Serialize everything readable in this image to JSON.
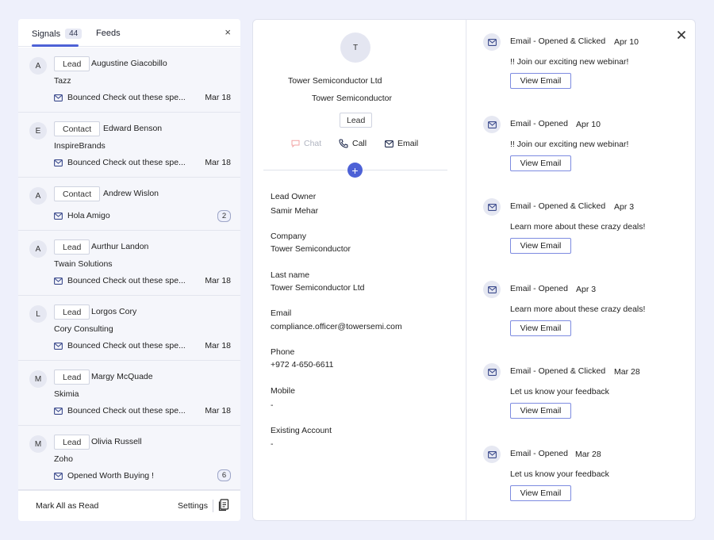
{
  "signals": {
    "tab_signals": "Signals",
    "signals_count": "44",
    "tab_feeds": "Feeds",
    "close_glyph": "×",
    "items": [
      {
        "avatar": "A",
        "type": "Lead",
        "name": "Augustine Giacobillo",
        "company": "Tazz",
        "activity": "Bounced Check out these spe...",
        "date": "Mar 18",
        "badge": ""
      },
      {
        "avatar": "E",
        "type": "Contact",
        "name": "Edward Benson",
        "company": "InspireBrands",
        "activity": "Bounced Check out these spe...",
        "date": "Mar 18",
        "badge": ""
      },
      {
        "avatar": "A",
        "type": "Contact",
        "name": "Andrew Wislon",
        "company": "",
        "activity": "Hola Amigo",
        "date": "",
        "badge": "2"
      },
      {
        "avatar": "A",
        "type": "Lead",
        "name": "Aurthur Landon",
        "company": "Twain Solutions",
        "activity": "Bounced Check out these spe...",
        "date": "Mar 18",
        "badge": ""
      },
      {
        "avatar": "L",
        "type": "Lead",
        "name": "Lorgos Cory",
        "company": "Cory Consulting",
        "activity": "Bounced Check out these spe...",
        "date": "Mar 18",
        "badge": ""
      },
      {
        "avatar": "M",
        "type": "Lead",
        "name": "Margy McQuade",
        "company": "Skimia",
        "activity": "Bounced Check out these spe...",
        "date": "Mar 18",
        "badge": ""
      },
      {
        "avatar": "M",
        "type": "Lead",
        "name": "Olivia Russell",
        "company": "Zoho",
        "activity": "Opened Worth Buying !",
        "date": "",
        "badge": "6"
      }
    ],
    "footer": {
      "mark_all": "Mark All as Read",
      "settings": "Settings"
    }
  },
  "profile": {
    "avatar": "T",
    "line1": "Tower Semiconductor Ltd",
    "line2": "Tower Semiconductor",
    "type": "Lead",
    "actions": {
      "chat": "Chat",
      "call": "Call",
      "email": "Email"
    },
    "add_glyph": "+",
    "fields": [
      {
        "label": "Lead Owner",
        "value": "Samir Mehar"
      },
      {
        "label": "Company",
        "value": "Tower Semiconductor"
      },
      {
        "label": "Last name",
        "value": "Tower Semiconductor Ltd"
      },
      {
        "label": "Email",
        "value": "compliance.officer@towersemi.com"
      },
      {
        "label": "Phone",
        "value": "+972 4-650-6611"
      },
      {
        "label": "Mobile",
        "value": "-"
      },
      {
        "label": "Existing Account",
        "value": "-"
      }
    ]
  },
  "timeline": {
    "view_label": "View Email",
    "items": [
      {
        "status": "Email - Opened & Clicked",
        "date": "Apr 10",
        "subject": "!! Join our exciting new webinar!"
      },
      {
        "status": "Email - Opened",
        "date": "Apr 10",
        "subject": "!! Join our exciting new webinar!"
      },
      {
        "status": "Email - Opened & Clicked",
        "date": "Apr 3",
        "subject": "Learn more about these crazy deals!"
      },
      {
        "status": "Email - Opened",
        "date": "Apr 3",
        "subject": "Learn more about these crazy deals!"
      },
      {
        "status": "Email - Opened & Clicked",
        "date": "Mar 28",
        "subject": "Let us know your feedback"
      },
      {
        "status": "Email - Opened",
        "date": "Mar 28",
        "subject": "Let us know your feedback"
      }
    ]
  },
  "colors": {
    "accent": "#4d61d6",
    "background": "#eef0fb",
    "panel": "#f5f6fb"
  }
}
